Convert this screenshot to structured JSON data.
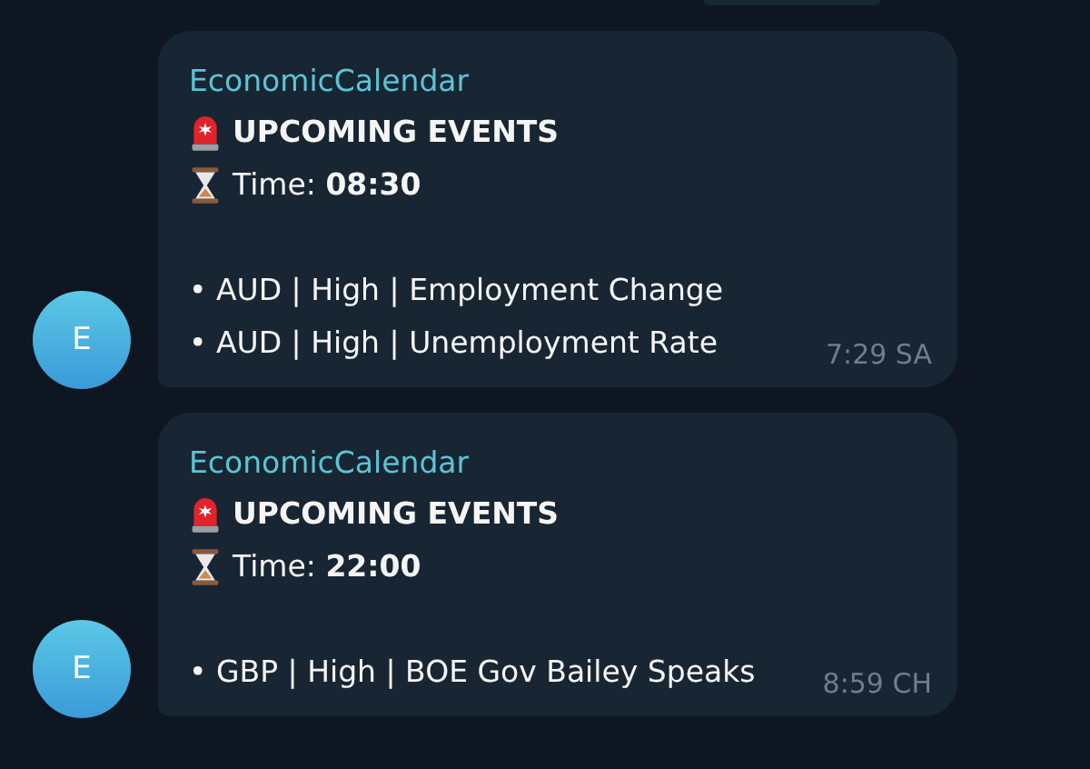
{
  "messages": [
    {
      "sender": "EconomicCalendar",
      "avatar_letter": "E",
      "heading": "UPCOMING EVENTS",
      "time_line": "Time: **08:30**",
      "lines": [
        "• AUD | High | Employment Change",
        "• AUD | High | Unemployment Rate"
      ],
      "timestamp": "7:29 SA"
    },
    {
      "sender": "EconomicCalendar",
      "avatar_letter": "E",
      "heading": "UPCOMING EVENTS",
      "time_line": "Time: **22:00**",
      "lines": [
        "• GBP | High | BOE Gov Bailey Speaks"
      ],
      "timestamp": "8:59 CH"
    }
  ]
}
